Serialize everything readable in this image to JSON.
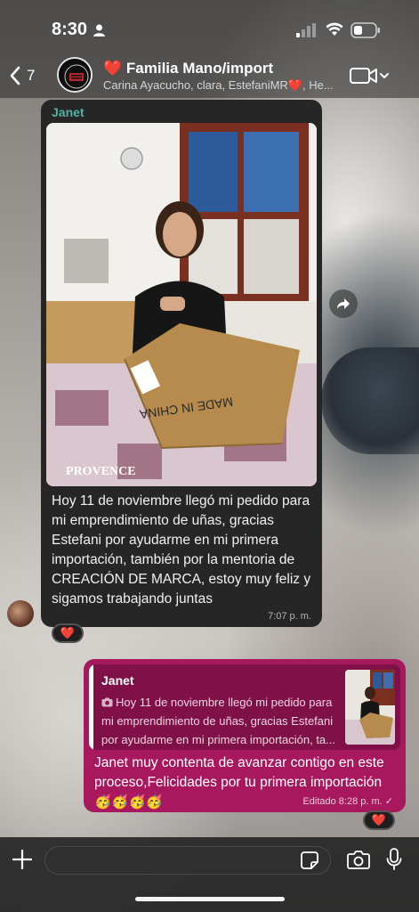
{
  "status_bar": {
    "time": "8:30"
  },
  "header": {
    "back_count": "7",
    "title": "❤️ Familia Mano/import",
    "subtitle": "Carina Ayacucho, clara, EstefaniMR❤️, He..."
  },
  "incoming": {
    "sender": "Janet",
    "text": "Hoy 11 de noviembre llegó mi pedido para mi emprendimiento de uñas, gracias Estefani por ayudarme en mi primera importación, también por la mentoria de CREACIÓN DE MARCA, estoy muy feliz y sigamos trabajando juntas",
    "time": "7:07 p. m.",
    "reaction": "❤️",
    "box_label": "MADE IN CHINA"
  },
  "outgoing": {
    "quote_name": "Janet",
    "quote_text": "Hoy 11 de noviembre llegó mi pedido para mi emprendimiento de uñas, gracias Estefani por ayudarme en mi primera importación, ta...",
    "text": "Janet muy contenta de avanzar contigo en este proceso,Felicidades por tu primera importación 🥳🥳🥳🥳",
    "time": "Editado  8:28 p. m.",
    "reaction": "❤️"
  },
  "composer": {
    "placeholder": ""
  },
  "colors": {
    "incoming_bubble": "#262626",
    "outgoing_bubble": "#a7185e",
    "sender_name": "#51b3a4"
  },
  "icons": [
    "person-icon",
    "signal-icon",
    "wifi-icon",
    "battery-icon",
    "back-chevron-icon",
    "video-call-icon",
    "forward-icon",
    "plus-icon",
    "sticker-icon",
    "camera-icon",
    "mic-icon"
  ]
}
